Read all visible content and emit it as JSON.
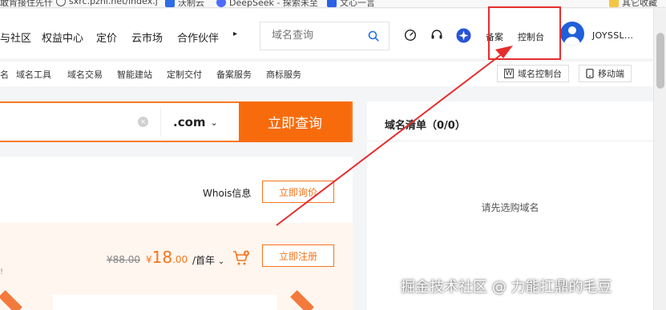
{
  "bookmarks": [
    "敢肯接住先什",
    "sxrc.pzhl.net/index.j",
    "沃制云",
    "DeepSeek - 探索未至",
    "文心一言",
    "其它收藏"
  ],
  "nav": {
    "items": [
      "与社区",
      "权益中心",
      "定价",
      "云市场",
      "合作伙伴"
    ],
    "more_glyph": "▸",
    "search_placeholder": "域名查询",
    "beian": "备案",
    "console": "控制台",
    "username": "JOYSSL..."
  },
  "subnav": {
    "items": [
      "名",
      "域名工具",
      "域名交易",
      "智能建站",
      "定制交付",
      "备案服务",
      "商标服务"
    ],
    "domain_console": "域名控制台",
    "domain_console_glyph": "W",
    "mobile": "移动端"
  },
  "domain_search": {
    "tld": ".com",
    "query_button": "立即查询"
  },
  "result": {
    "whois_label": "Whois信息",
    "inquire_button": "立即询价",
    "exclaim": "!",
    "old_price": "¥88.00",
    "new_price_symbol": "¥",
    "new_price_int": "18",
    "new_price_dec": ".00",
    "term": "/首年",
    "register_button": "立即注册"
  },
  "domain_list": {
    "title": "域名清单（0/0）",
    "empty_text": "请先选购域名"
  },
  "watermark": "掘金技术社区 @ 力能扛鼎的毛豆",
  "colors": {
    "accent": "#f76b0d",
    "annotation": "#e62d2d"
  }
}
